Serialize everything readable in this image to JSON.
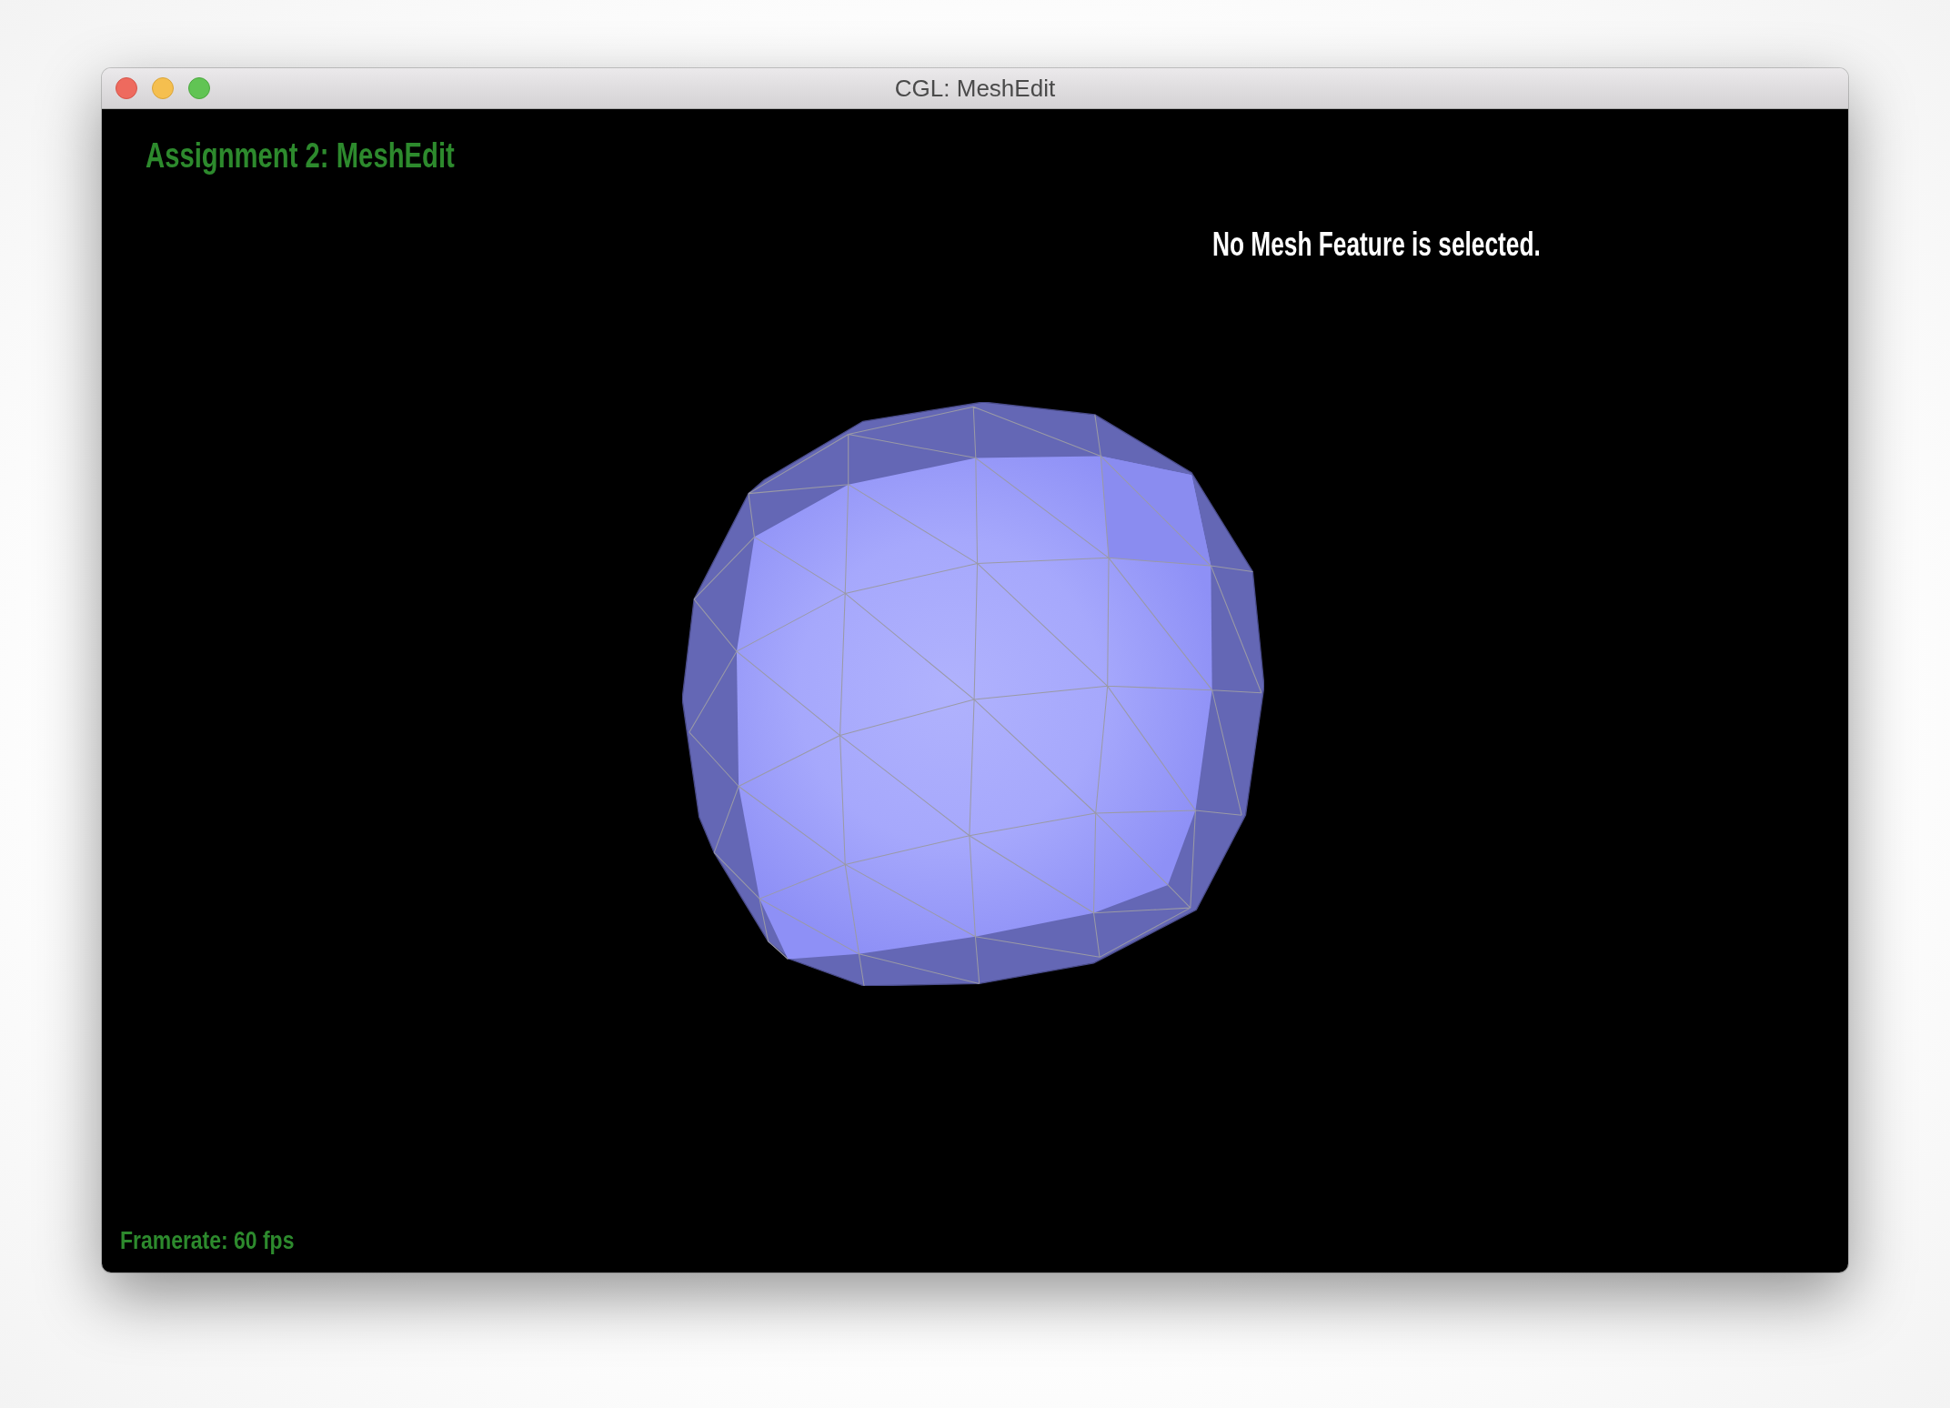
{
  "window": {
    "title": "CGL: MeshEdit"
  },
  "viewport": {
    "heading": "Assignment 2: MeshEdit",
    "selection_status": "No Mesh Feature is selected.",
    "framerate": "Framerate: 60 fps"
  }
}
